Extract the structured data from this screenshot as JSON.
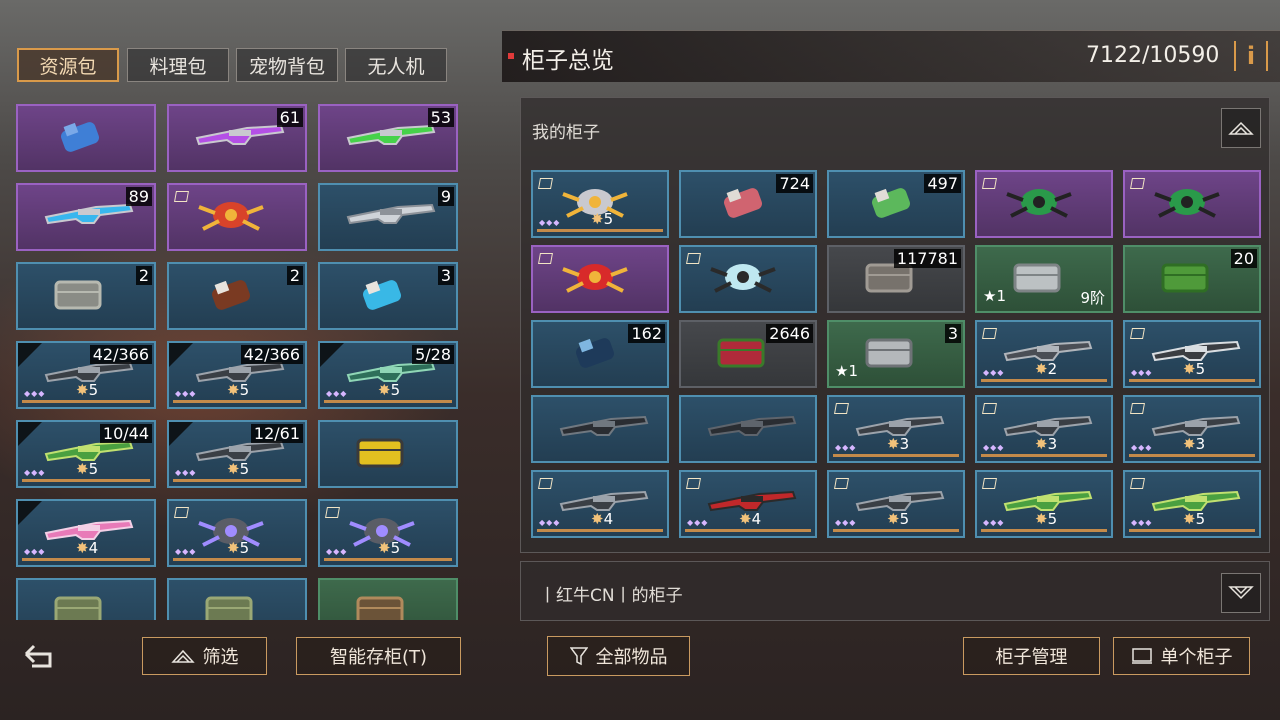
{
  "left_tabs": [
    "资源包",
    "料理包",
    "宠物背包",
    "无人机"
  ],
  "left_buttons": {
    "filter": "筛选",
    "smart_store": "智能存柜(T)"
  },
  "right_header": {
    "title": "柜子总览",
    "capacity": "7122/10590",
    "info_glyph": "i"
  },
  "my_locker": {
    "title": "我的柜子"
  },
  "other_locker": {
    "title": "丨红牛CN丨的柜子"
  },
  "right_buttons": {
    "all_items": "全部物品",
    "locker_manage": "柜子管理",
    "single_locker": "单个柜子"
  },
  "left_items": [
    {
      "count": "",
      "rarity": "purple",
      "icon": "flask-icon"
    },
    {
      "count": "61",
      "rarity": "purple",
      "icon": "purple-syringe-icon"
    },
    {
      "count": "53",
      "rarity": "purple",
      "icon": "green-syringe-icon"
    },
    {
      "count": "89",
      "rarity": "purple",
      "icon": "blue-syringe-icon"
    },
    {
      "count": "",
      "rarity": "purple",
      "icon": "mech-drone-icon",
      "gem": true
    },
    {
      "count": "9",
      "rarity": "blue",
      "icon": "syringe-icon"
    },
    {
      "count": "2",
      "rarity": "blue",
      "icon": "crate-icon"
    },
    {
      "count": "2",
      "rarity": "blue",
      "icon": "bottle-icon"
    },
    {
      "count": "3",
      "rarity": "blue",
      "icon": "blue-potion-icon"
    },
    {
      "count": "42/366",
      "rarity": "blue",
      "icon": "rifle-icon",
      "level": "5",
      "corner": true
    },
    {
      "count": "42/366",
      "rarity": "blue",
      "icon": "rifle-icon",
      "level": "5",
      "corner": true
    },
    {
      "count": "5/28",
      "rarity": "blue",
      "icon": "launcher-icon",
      "level": "5",
      "corner": true
    },
    {
      "count": "10/44",
      "rarity": "blue",
      "icon": "green-rifle-icon",
      "level": "5",
      "corner": true
    },
    {
      "count": "12/61",
      "rarity": "blue",
      "icon": "rifle-icon",
      "level": "5",
      "corner": true
    },
    {
      "count": "",
      "rarity": "blue",
      "icon": "yellow-vehicle-icon"
    },
    {
      "count": "",
      "rarity": "blue",
      "icon": "pink-blade-icon",
      "level": "4",
      "corner": true
    },
    {
      "count": "",
      "rarity": "blue",
      "icon": "robot-icon",
      "level": "5",
      "gem": true
    },
    {
      "count": "",
      "rarity": "blue",
      "icon": "robot-icon",
      "level": "5",
      "gem": true
    },
    {
      "count": "",
      "rarity": "blue",
      "icon": "chest-icon"
    },
    {
      "count": "",
      "rarity": "blue",
      "icon": "chest-icon"
    },
    {
      "count": "",
      "rarity": "green",
      "icon": "frame-icon"
    }
  ],
  "right_items": [
    {
      "count": "",
      "rarity": "blue",
      "icon": "armor-icon",
      "level": "5",
      "gem": true
    },
    {
      "count": "724",
      "rarity": "blue",
      "icon": "red-vial-icon"
    },
    {
      "count": "497",
      "rarity": "blue",
      "icon": "green-vial-icon"
    },
    {
      "count": "",
      "rarity": "purple",
      "icon": "green-drone-icon",
      "gem": true
    },
    {
      "count": "",
      "rarity": "purple",
      "icon": "green-drone-icon",
      "gem": true
    },
    {
      "count": "",
      "rarity": "purple",
      "icon": "red-drone-icon",
      "gem": true
    },
    {
      "count": "",
      "rarity": "blue",
      "icon": "glider-icon",
      "gem": true
    },
    {
      "count": "117781",
      "rarity": "gray",
      "icon": "stone-icon"
    },
    {
      "count": "",
      "rarity": "green",
      "icon": "metal-sheet-icon",
      "star": "1",
      "stage": "9阶"
    },
    {
      "count": "20",
      "rarity": "green",
      "icon": "leaf-icon"
    },
    {
      "count": "162",
      "rarity": "blue",
      "icon": "canister-icon"
    },
    {
      "count": "2646",
      "rarity": "gray",
      "icon": "berries-icon"
    },
    {
      "count": "3",
      "rarity": "green",
      "icon": "pipes-icon",
      "star": "1"
    },
    {
      "count": "",
      "rarity": "blue",
      "icon": "pistol-icon",
      "level": "2",
      "gem": true
    },
    {
      "count": "",
      "rarity": "blue",
      "icon": "locked-gun-icon",
      "level": "5",
      "gem": true
    },
    {
      "count": "",
      "rarity": "blue",
      "icon": "sniper-icon"
    },
    {
      "count": "",
      "rarity": "blue",
      "icon": "smg-icon"
    },
    {
      "count": "",
      "rarity": "blue",
      "icon": "rifle-icon",
      "level": "3",
      "gem": true
    },
    {
      "count": "",
      "rarity": "blue",
      "icon": "rifle-icon",
      "level": "3",
      "gem": true
    },
    {
      "count": "",
      "rarity": "blue",
      "icon": "rifle-icon",
      "level": "3",
      "gem": true
    },
    {
      "count": "",
      "rarity": "blue",
      "icon": "rifle-icon",
      "level": "4",
      "gem": true
    },
    {
      "count": "",
      "rarity": "blue",
      "icon": "red-rifle-icon",
      "level": "4",
      "gem": true
    },
    {
      "count": "",
      "rarity": "blue",
      "icon": "rifle-icon",
      "level": "5",
      "gem": true
    },
    {
      "count": "",
      "rarity": "blue",
      "icon": "green-rifle-icon",
      "level": "5",
      "gem": true
    },
    {
      "count": "",
      "rarity": "blue",
      "icon": "green-rifle-icon",
      "level": "5",
      "gem": true
    }
  ],
  "colors": {
    "accent": "#d99a4a",
    "blue_rarity": "#4f8fb0",
    "purple_rarity": "#9a62c2",
    "green_rarity": "#4f8e68"
  }
}
